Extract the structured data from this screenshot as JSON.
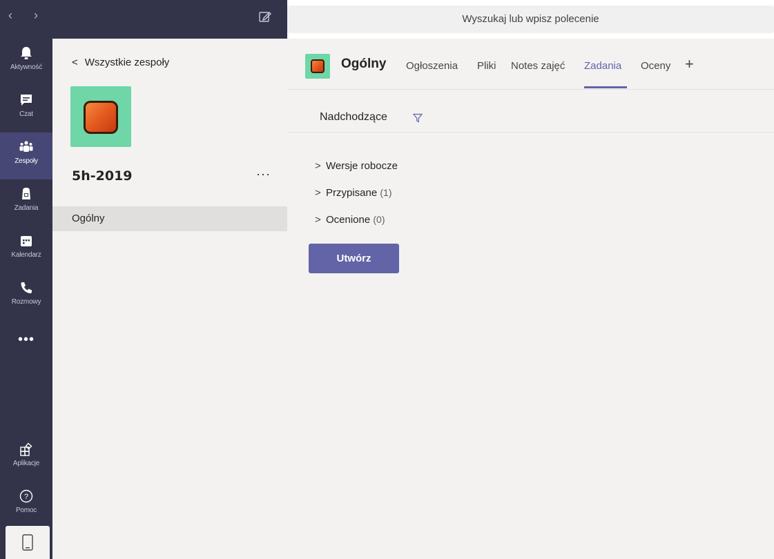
{
  "topbar": {
    "back_arrow": "‹",
    "forward_arrow": "›",
    "search_placeholder": "Wyszukaj lub wpisz polecenie"
  },
  "rail": {
    "items": [
      {
        "label": "Aktywność",
        "icon": "bell-icon"
      },
      {
        "label": "Czat",
        "icon": "chat-icon"
      },
      {
        "label": "Zespoły",
        "icon": "teams-icon",
        "active": true
      },
      {
        "label": "Zadania",
        "icon": "assignments-icon"
      },
      {
        "label": "Kalendarz",
        "icon": "calendar-icon"
      },
      {
        "label": "Rozmowy",
        "icon": "phone-icon"
      }
    ],
    "more": "•••",
    "bottom": [
      {
        "label": "Aplikacje",
        "icon": "apps-icon"
      },
      {
        "label": "Pomoc",
        "icon": "help-icon"
      }
    ]
  },
  "teams_panel": {
    "back_label": "Wszystkie zespoły",
    "team_name": "5h-2019",
    "more": "···",
    "channel": "Ogólny"
  },
  "main": {
    "channel_title": "Ogólny",
    "tabs": [
      "Ogłoszenia",
      "Pliki",
      "Notes zajęć",
      "Zadania",
      "Oceny"
    ],
    "active_tab": "Zadania",
    "add_tab": "+",
    "filter_label": "Nadchodzące",
    "sections": [
      {
        "name": "Wersje robocze",
        "count": ""
      },
      {
        "name": "Przypisane",
        "count": "(1)"
      },
      {
        "name": "Ocenione",
        "count": "(0)"
      }
    ],
    "create_label": "Utwórz"
  },
  "colors": {
    "rail_bg": "#33344a",
    "accent": "#6264a7",
    "team_avatar_bg": "#6fd6a7"
  }
}
